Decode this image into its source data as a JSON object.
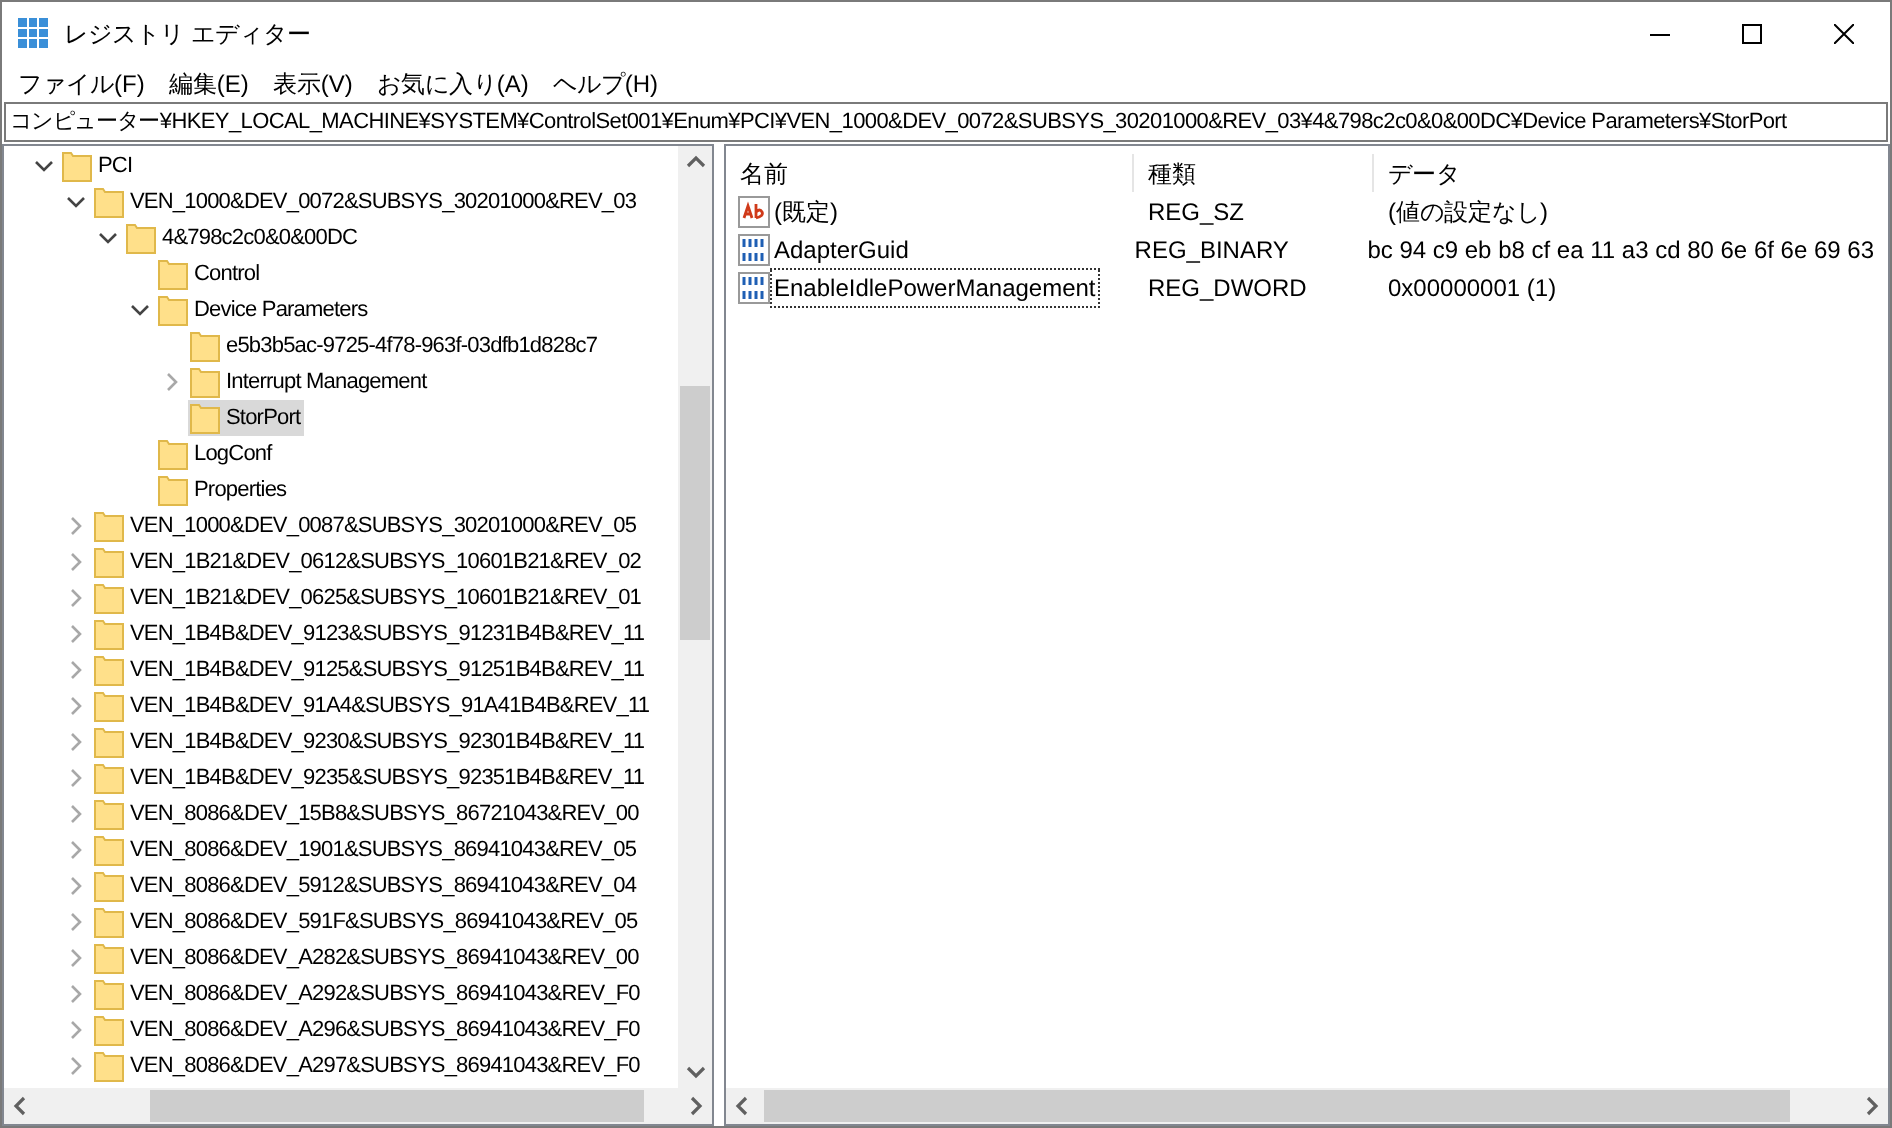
{
  "window": {
    "title": "レジストリ エディター"
  },
  "menu": [
    "ファイル(F)",
    "編集(E)",
    "表示(V)",
    "お気に入り(A)",
    "ヘルプ(H)"
  ],
  "address": "コンピューター¥HKEY_LOCAL_MACHINE¥SYSTEM¥ControlSet001¥Enum¥PCI¥VEN_1000&DEV_0072&SUBSYS_30201000&REV_03¥4&798c2c0&0&00DC¥Device Parameters¥StorPort",
  "tree": [
    {
      "label": "PCI",
      "kind": "branch",
      "expanded": true,
      "selected": false,
      "children": [
        {
          "label": "VEN_1000&DEV_0072&SUBSYS_30201000&REV_03",
          "kind": "branch",
          "expanded": true,
          "selected": false,
          "children": [
            {
              "label": "4&798c2c0&0&00DC",
              "kind": "branch",
              "expanded": true,
              "selected": false,
              "children": [
                {
                  "label": "Control",
                  "kind": "leaf",
                  "selected": false
                },
                {
                  "label": "Device Parameters",
                  "kind": "branch",
                  "expanded": true,
                  "selected": false,
                  "children": [
                    {
                      "label": "e5b3b5ac-9725-4f78-963f-03dfb1d828c7",
                      "kind": "leaf",
                      "selected": false
                    },
                    {
                      "label": "Interrupt Management",
                      "kind": "branch",
                      "expanded": false,
                      "selected": false
                    },
                    {
                      "label": "StorPort",
                      "kind": "leaf",
                      "selected": true
                    }
                  ]
                },
                {
                  "label": "LogConf",
                  "kind": "leaf",
                  "selected": false
                },
                {
                  "label": "Properties",
                  "kind": "leaf",
                  "selected": false
                }
              ]
            }
          ]
        },
        {
          "label": "VEN_1000&DEV_0087&SUBSYS_30201000&REV_05",
          "kind": "branch",
          "expanded": false,
          "selected": false
        },
        {
          "label": "VEN_1B21&DEV_0612&SUBSYS_10601B21&REV_02",
          "kind": "branch",
          "expanded": false,
          "selected": false
        },
        {
          "label": "VEN_1B21&DEV_0625&SUBSYS_10601B21&REV_01",
          "kind": "branch",
          "expanded": false,
          "selected": false
        },
        {
          "label": "VEN_1B4B&DEV_9123&SUBSYS_91231B4B&REV_11",
          "kind": "branch",
          "expanded": false,
          "selected": false
        },
        {
          "label": "VEN_1B4B&DEV_9125&SUBSYS_91251B4B&REV_11",
          "kind": "branch",
          "expanded": false,
          "selected": false
        },
        {
          "label": "VEN_1B4B&DEV_91A4&SUBSYS_91A41B4B&REV_11",
          "kind": "branch",
          "expanded": false,
          "selected": false
        },
        {
          "label": "VEN_1B4B&DEV_9230&SUBSYS_92301B4B&REV_11",
          "kind": "branch",
          "expanded": false,
          "selected": false
        },
        {
          "label": "VEN_1B4B&DEV_9235&SUBSYS_92351B4B&REV_11",
          "kind": "branch",
          "expanded": false,
          "selected": false
        },
        {
          "label": "VEN_8086&DEV_15B8&SUBSYS_86721043&REV_00",
          "kind": "branch",
          "expanded": false,
          "selected": false
        },
        {
          "label": "VEN_8086&DEV_1901&SUBSYS_86941043&REV_05",
          "kind": "branch",
          "expanded": false,
          "selected": false
        },
        {
          "label": "VEN_8086&DEV_5912&SUBSYS_86941043&REV_04",
          "kind": "branch",
          "expanded": false,
          "selected": false
        },
        {
          "label": "VEN_8086&DEV_591F&SUBSYS_86941043&REV_05",
          "kind": "branch",
          "expanded": false,
          "selected": false
        },
        {
          "label": "VEN_8086&DEV_A282&SUBSYS_86941043&REV_00",
          "kind": "branch",
          "expanded": false,
          "selected": false
        },
        {
          "label": "VEN_8086&DEV_A292&SUBSYS_86941043&REV_F0",
          "kind": "branch",
          "expanded": false,
          "selected": false
        },
        {
          "label": "VEN_8086&DEV_A296&SUBSYS_86941043&REV_F0",
          "kind": "branch",
          "expanded": false,
          "selected": false
        },
        {
          "label": "VEN_8086&DEV_A297&SUBSYS_86941043&REV_F0",
          "kind": "branch",
          "expanded": false,
          "selected": false
        }
      ]
    }
  ],
  "values": {
    "columns": [
      "名前",
      "種類",
      "データ"
    ],
    "rows": [
      {
        "kind": "string",
        "name": "(既定)",
        "type": "REG_SZ",
        "data": "(値の設定なし)",
        "selected": false
      },
      {
        "kind": "binary",
        "name": "AdapterGuid",
        "type": "REG_BINARY",
        "data": "bc 94 c9 eb b8 cf ea 11 a3 cd 80 6e 6f 6e 69 63",
        "selected": false
      },
      {
        "kind": "binary",
        "name": "EnableIdlePowerManagement",
        "type": "REG_DWORD",
        "data": "0x00000001 (1)",
        "selected": true
      }
    ]
  }
}
